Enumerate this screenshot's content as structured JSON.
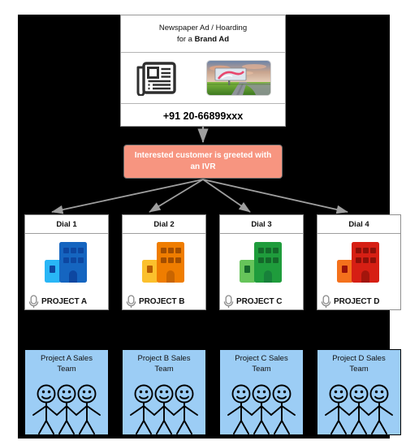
{
  "diagram": {
    "title": "IVR call routing flow for a brand advertisement",
    "background_color": "#000000",
    "page_background": "#ffffff"
  },
  "ad_card": {
    "name": "newspaper-ad-card",
    "title_line1": "Newspaper Ad / Hoarding",
    "title_line2_prefix": "for a ",
    "title_line2_bold": "Brand Ad",
    "newspaper_icon": "newspaper-icon",
    "hoarding_image": "billboard-photo",
    "phone_number": "+91 20-66899xxx"
  },
  "ivr": {
    "name": "ivr-greeting-box",
    "text": "Interested customer is greeted with an IVR",
    "fill_color": "#f79580",
    "text_color": "#ffffff"
  },
  "dials": [
    {
      "head": "Dial 1",
      "project": "PROJECT A",
      "icon": "office-building-icon",
      "color_main": "#1565c0",
      "color_dark": "#0d47a1",
      "color_side": "#29b6f6",
      "mic_icon": "microphone-icon"
    },
    {
      "head": "Dial 2",
      "project": "PROJECT B",
      "icon": "office-building-icon",
      "color_main": "#ef7d00",
      "color_dark": "#b85c00",
      "color_side": "#fbc02d",
      "mic_icon": "microphone-icon"
    },
    {
      "head": "Dial 3",
      "project": "PROJECT C",
      "icon": "office-building-icon",
      "color_main": "#1f9c3c",
      "color_dark": "#14682a",
      "color_side": "#66c45a",
      "mic_icon": "microphone-icon"
    },
    {
      "head": "Dial 4",
      "project": "PROJECT D",
      "icon": "office-building-icon",
      "color_main": "#d61f14",
      "color_dark": "#9b1209",
      "color_side": "#f4711c",
      "mic_icon": "microphone-icon"
    }
  ],
  "teams": [
    {
      "line1": "Project A Sales",
      "line2": "Team",
      "fill_color": "#9ccdf5"
    },
    {
      "line1": "Project B Sales",
      "line2": "Team",
      "fill_color": "#9ccdf5"
    },
    {
      "line1": "Project C Sales",
      "line2": "Team",
      "fill_color": "#9ccdf5"
    },
    {
      "line1": "Project D Sales",
      "line2": "Team",
      "fill_color": "#9ccdf5"
    }
  ],
  "connectors": {
    "color": "#9e9e9e",
    "ad_to_ivr": "vertical-arrow",
    "ivr_to_dials": "four-fan-arrows"
  }
}
